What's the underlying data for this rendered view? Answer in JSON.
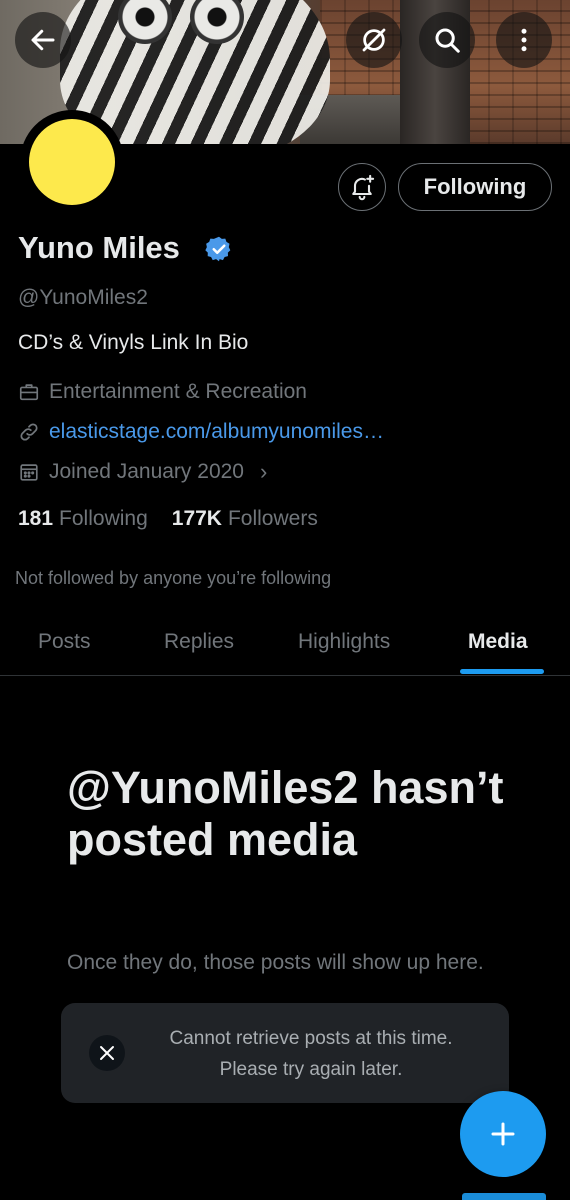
{
  "header": {
    "icons": [
      "back-arrow-icon",
      "no-grok-icon",
      "search-icon",
      "more-vertical-icon"
    ]
  },
  "profile": {
    "name": "Yuno Miles",
    "verified": true,
    "handle": "@YunoMiles2",
    "bio": "CD’s & Vinyls Link In Bio",
    "category": "Entertainment & Recreation",
    "website": "elasticstage.com/albumyunomiles…",
    "joined": "Joined January 2020",
    "following_count": "181",
    "following_label": "Following",
    "followers_count": "177K",
    "followers_label": "Followers",
    "not_followed_note": "Not followed by anyone you’re following",
    "follow_button_label": "Following",
    "avatar_color": "#fde94c"
  },
  "tabs": [
    {
      "label": "Posts",
      "active": false
    },
    {
      "label": "Replies",
      "active": false
    },
    {
      "label": "Highlights",
      "active": false
    },
    {
      "label": "Media",
      "active": true
    }
  ],
  "empty_state": {
    "title": "@YunoMiles2 hasn’t posted media",
    "subtitle": "Once they do, those posts will show up here."
  },
  "toast": {
    "message": "Cannot retrieve posts at this time. Please try again later."
  },
  "colors": {
    "accent": "#1d9bf0",
    "link": "#4a99e9",
    "muted": "#71767b",
    "background": "#000000"
  }
}
